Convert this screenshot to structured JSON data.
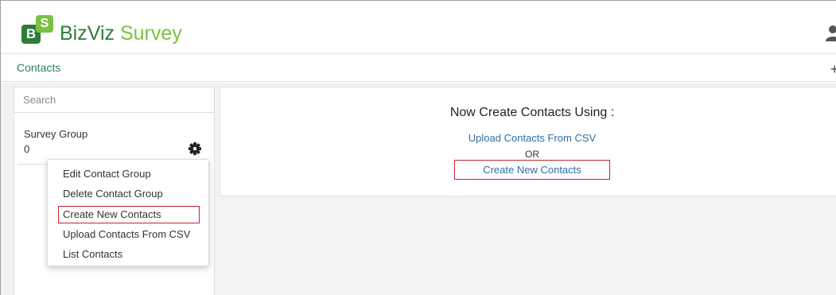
{
  "header": {
    "logo_b": "B",
    "logo_s": "S",
    "brand_part1": "BizViz",
    "brand_part2": "Survey",
    "colors": {
      "brand_dark": "#2e7d3a",
      "brand_light": "#7cc142"
    }
  },
  "subheader": {
    "title": "Contacts",
    "add_icon": "plus-icon"
  },
  "sidebar": {
    "search_placeholder": "Search",
    "group": {
      "name": "Survey Group",
      "count": "0"
    },
    "menu": {
      "items": [
        {
          "label": "Edit Contact Group"
        },
        {
          "label": "Delete Contact Group"
        },
        {
          "label": "Create New Contacts",
          "highlighted": true
        },
        {
          "label": "Upload Contacts From CSV"
        },
        {
          "label": "List Contacts"
        }
      ]
    }
  },
  "main": {
    "title": "Now Create Contacts Using :",
    "upload_link": "Upload Contacts From CSV",
    "or_text": "OR",
    "create_link": "Create New Contacts",
    "colors": {
      "link": "#2c6ea8",
      "highlight_border": "#c1272d"
    }
  }
}
